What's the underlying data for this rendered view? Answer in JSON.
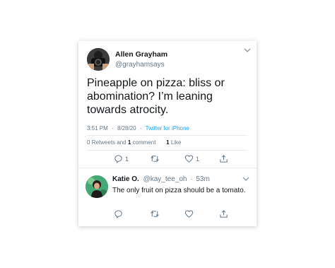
{
  "tweet": {
    "author_name": "Allen Grayham",
    "author_handle": "@grayhamsays",
    "text": "Pineapple on pizza: bliss or abomination? I’m leaning towards atrocity.",
    "time": "3:51 PM",
    "date": "8/28/20",
    "source": "Twitter for iPhone",
    "dot": "·",
    "stats": {
      "retweets_count": "0",
      "retweets_label": "Retweets and",
      "comments_count": "1",
      "comments_label": "comment",
      "likes_count": "1",
      "likes_label": "Like"
    },
    "actions": {
      "reply_count": "1",
      "like_count": "1"
    }
  },
  "reply": {
    "author_name": "Katie O.",
    "author_handle": "@kay_tee_oh",
    "dot": "·",
    "age": "53m",
    "text": "The only fruit on pizza should be a tomato."
  },
  "colors": {
    "accent": "#1da1f2",
    "muted": "#657786",
    "divider": "#e6ecf0"
  },
  "icons": [
    "chevron-down-icon",
    "reply-icon",
    "retweet-icon",
    "heart-icon",
    "share-icon"
  ]
}
